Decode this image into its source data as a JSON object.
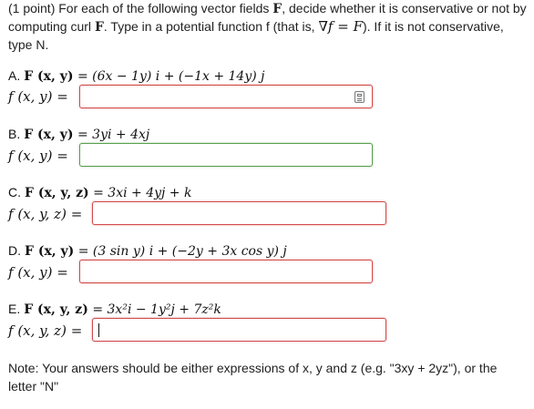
{
  "intro": {
    "points": "(1 point)",
    "text1": "For each of the following vector fields",
    "F": "F",
    "text2": ", decide whether it is conservative or not by computing curl",
    "text3": ". Type in a potential function f (that is,",
    "grad_eq": "∇f = F",
    "text4": "). If it is not conservative, type N."
  },
  "problems": [
    {
      "letter": "A.",
      "field_lhs": "F (x, y)",
      "field_rhs": "= (6x − 1y) i + (−1x + 14y) j",
      "answer_label": "f (x, y) =",
      "answer_value": "",
      "answer_state": "error",
      "has_preview_icon": true
    },
    {
      "letter": "B.",
      "field_lhs": "F (x, y)",
      "field_rhs": "= 3yi + 4xj",
      "answer_label": "f (x, y) =",
      "answer_value": "",
      "answer_state": "correct",
      "has_preview_icon": false
    },
    {
      "letter": "C.",
      "field_lhs": "F (x, y, z)",
      "field_rhs": "= 3xi + 4yj + k",
      "answer_label": "f (x, y, z) =",
      "answer_value": "",
      "answer_state": "error",
      "has_preview_icon": false
    },
    {
      "letter": "D.",
      "field_lhs": "F (x, y)",
      "field_rhs": "= (3 sin y) i + (−2y + 3x cos y) j",
      "answer_label": "f (x, y) =",
      "answer_value": "",
      "answer_state": "error",
      "has_preview_icon": false
    },
    {
      "letter": "E.",
      "field_lhs": "F (x, y, z)",
      "field_rhs": "= 3x²i − 1y²j + 7z²k",
      "answer_label": "f (x, y, z) =",
      "answer_value": "",
      "answer_state": "error-focused",
      "has_preview_icon": false
    }
  ],
  "note": "Note: Your answers should be either expressions of x, y and z (e.g. \"3xy + 2yz\"), or the letter \"N\"",
  "colors": {
    "error_border": "#d34a4a",
    "correct_border": "#5a9e4f",
    "text": "#222222"
  },
  "icons": [
    "preview-icon"
  ]
}
